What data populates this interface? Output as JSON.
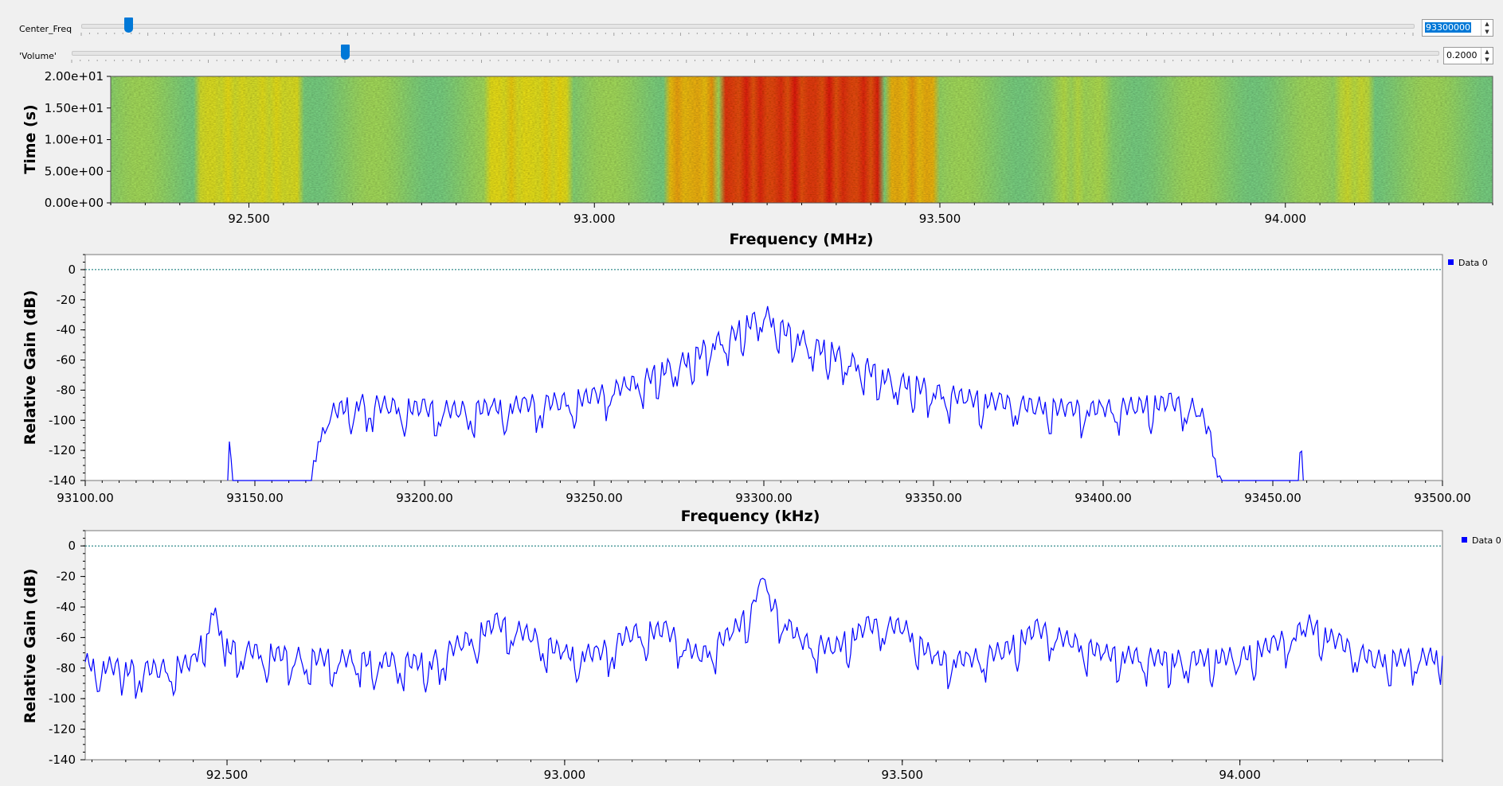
{
  "controls": {
    "center_freq": {
      "label": "Center_Freq",
      "value": "93300000",
      "position": 0.035
    },
    "volume": {
      "label": "'Volume'",
      "value": "0.2000",
      "position": 0.2
    }
  },
  "colors": {
    "trace": "#0000ff",
    "reference_line": "#007070",
    "legend_marker": "#0000ff",
    "slider_handle": "#0078d7"
  },
  "chart_data": [
    {
      "type": "heatmap",
      "ylabel": "Time (s)",
      "xlabel": "Frequency (MHz)",
      "xlim": [
        92.3,
        94.3
      ],
      "ylim": [
        0,
        20
      ],
      "yticks": [
        "0.00e+00",
        "5.00e+00",
        "1.00e+01",
        "1.50e+01",
        "2.00e+01"
      ],
      "ytick_values": [
        0,
        5,
        10,
        15,
        20
      ],
      "xticks": [
        "92.500",
        "93.000",
        "93.500",
        "94.000"
      ],
      "xtick_values": [
        92.5,
        93.0,
        93.5,
        94.0
      ],
      "bands_MHz": [
        {
          "center": 92.5,
          "width": 0.15,
          "level": 0.55
        },
        {
          "center": 92.9,
          "width": 0.12,
          "level": 0.6
        },
        {
          "center": 93.14,
          "width": 0.07,
          "level": 0.75
        },
        {
          "center": 93.3,
          "width": 0.22,
          "level": 1.0
        },
        {
          "center": 93.46,
          "width": 0.07,
          "level": 0.75
        },
        {
          "center": 93.7,
          "width": 0.08,
          "level": 0.35
        },
        {
          "center": 94.1,
          "width": 0.06,
          "level": 0.45
        }
      ]
    },
    {
      "type": "line",
      "xlabel": "Frequency (kHz)",
      "ylabel": "Relative Gain (dB)",
      "xlim": [
        93100,
        93500
      ],
      "ylim": [
        -140,
        10
      ],
      "xticks": [
        "93100.00",
        "93150.00",
        "93200.00",
        "93250.00",
        "93300.00",
        "93350.00",
        "93400.00",
        "93450.00",
        "93500.00"
      ],
      "xtick_values": [
        93100,
        93150,
        93200,
        93250,
        93300,
        93350,
        93400,
        93450,
        93500
      ],
      "yticks": [
        "0",
        "-20",
        "-40",
        "-60",
        "-80",
        "-100",
        "-120",
        "-140"
      ],
      "ytick_values": [
        0,
        -20,
        -40,
        -60,
        -80,
        -100,
        -120,
        -140
      ],
      "reference_db": 0,
      "legend": "Data 0",
      "series": [
        {
          "name": "Data 0",
          "x": [
            93142,
            93142.5,
            93143,
            93143.5,
            93166,
            93168,
            93170,
            93172,
            93175,
            93180,
            93190,
            93200,
            93210,
            93220,
            93230,
            93240,
            93250,
            93260,
            93265,
            93270,
            93275,
            93280,
            93285,
            93290,
            93295,
            93300,
            93305,
            93310,
            93315,
            93320,
            93325,
            93330,
            93335,
            93340,
            93345,
            93350,
            93360,
            93370,
            93380,
            93390,
            93400,
            93410,
            93420,
            93428,
            93431,
            93433,
            93435,
            93457.5,
            93458,
            93458.5,
            93459
          ],
          "y": [
            -140,
            -118,
            -120,
            -140,
            -140,
            -125,
            -110,
            -96,
            -92,
            -88,
            -90,
            -92,
            -93,
            -91,
            -89,
            -87,
            -84,
            -76,
            -72,
            -66,
            -62,
            -56,
            -48,
            -44,
            -36,
            -28,
            -38,
            -44,
            -50,
            -54,
            -60,
            -64,
            -70,
            -74,
            -76,
            -80,
            -85,
            -88,
            -90,
            -92,
            -92,
            -90,
            -88,
            -92,
            -106,
            -128,
            -140,
            -140,
            -118,
            -120,
            -140
          ]
        }
      ]
    },
    {
      "type": "line",
      "ylabel": "Relative Gain (dB)",
      "xlabel": "",
      "xlim": [
        92.29,
        94.3
      ],
      "ylim": [
        -140,
        10
      ],
      "xticks": [
        "92.500",
        "93.000",
        "93.500",
        "94.000"
      ],
      "xtick_values": [
        92.5,
        93.0,
        93.5,
        94.0
      ],
      "yticks": [
        "0",
        "-20",
        "-40",
        "-60",
        "-80",
        "-100",
        "-120",
        "-140"
      ],
      "ytick_values": [
        0,
        -20,
        -40,
        -60,
        -80,
        -100,
        -120,
        -140
      ],
      "reference_db": 0,
      "legend": "Data 0",
      "series": [
        {
          "name": "Data 0",
          "x": [
            92.29,
            92.35,
            92.4,
            92.45,
            92.47,
            92.48,
            92.5,
            92.6,
            92.7,
            92.8,
            92.85,
            92.9,
            92.95,
            93.0,
            93.05,
            93.1,
            93.15,
            93.2,
            93.25,
            93.28,
            93.29,
            93.3,
            93.35,
            93.4,
            93.45,
            93.5,
            93.55,
            93.6,
            93.65,
            93.7,
            93.75,
            93.8,
            93.9,
            94.0,
            94.05,
            94.08,
            94.1,
            94.15,
            94.2,
            94.3
          ],
          "y": [
            -76,
            -80,
            -80,
            -76,
            -56,
            -43,
            -66,
            -72,
            -74,
            -76,
            -62,
            -50,
            -58,
            -70,
            -70,
            -56,
            -55,
            -72,
            -55,
            -40,
            -16,
            -34,
            -62,
            -66,
            -52,
            -52,
            -74,
            -74,
            -68,
            -54,
            -62,
            -70,
            -74,
            -72,
            -64,
            -58,
            -50,
            -64,
            -74,
            -72
          ]
        }
      ]
    }
  ]
}
